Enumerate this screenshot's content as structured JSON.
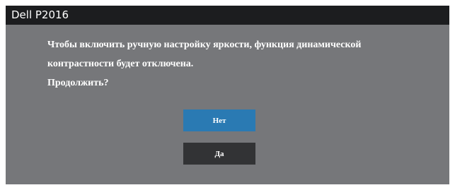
{
  "window": {
    "title": "Dell P2016"
  },
  "dialog": {
    "message_lines": [
      "Чтобы включить ручную настройку яркости, функция динамической",
      "контрастности будет отключена.",
      "Продолжить?"
    ],
    "buttons": {
      "no_label": "Нет",
      "yes_label": "Да"
    },
    "selected_button": "Нет",
    "colors": {
      "panel_background": "#76777a",
      "titlebar_background": "#1c1d1f",
      "selected_button": "#2a7ab3",
      "unselected_button": "#323335",
      "text": "#ffffff"
    }
  }
}
